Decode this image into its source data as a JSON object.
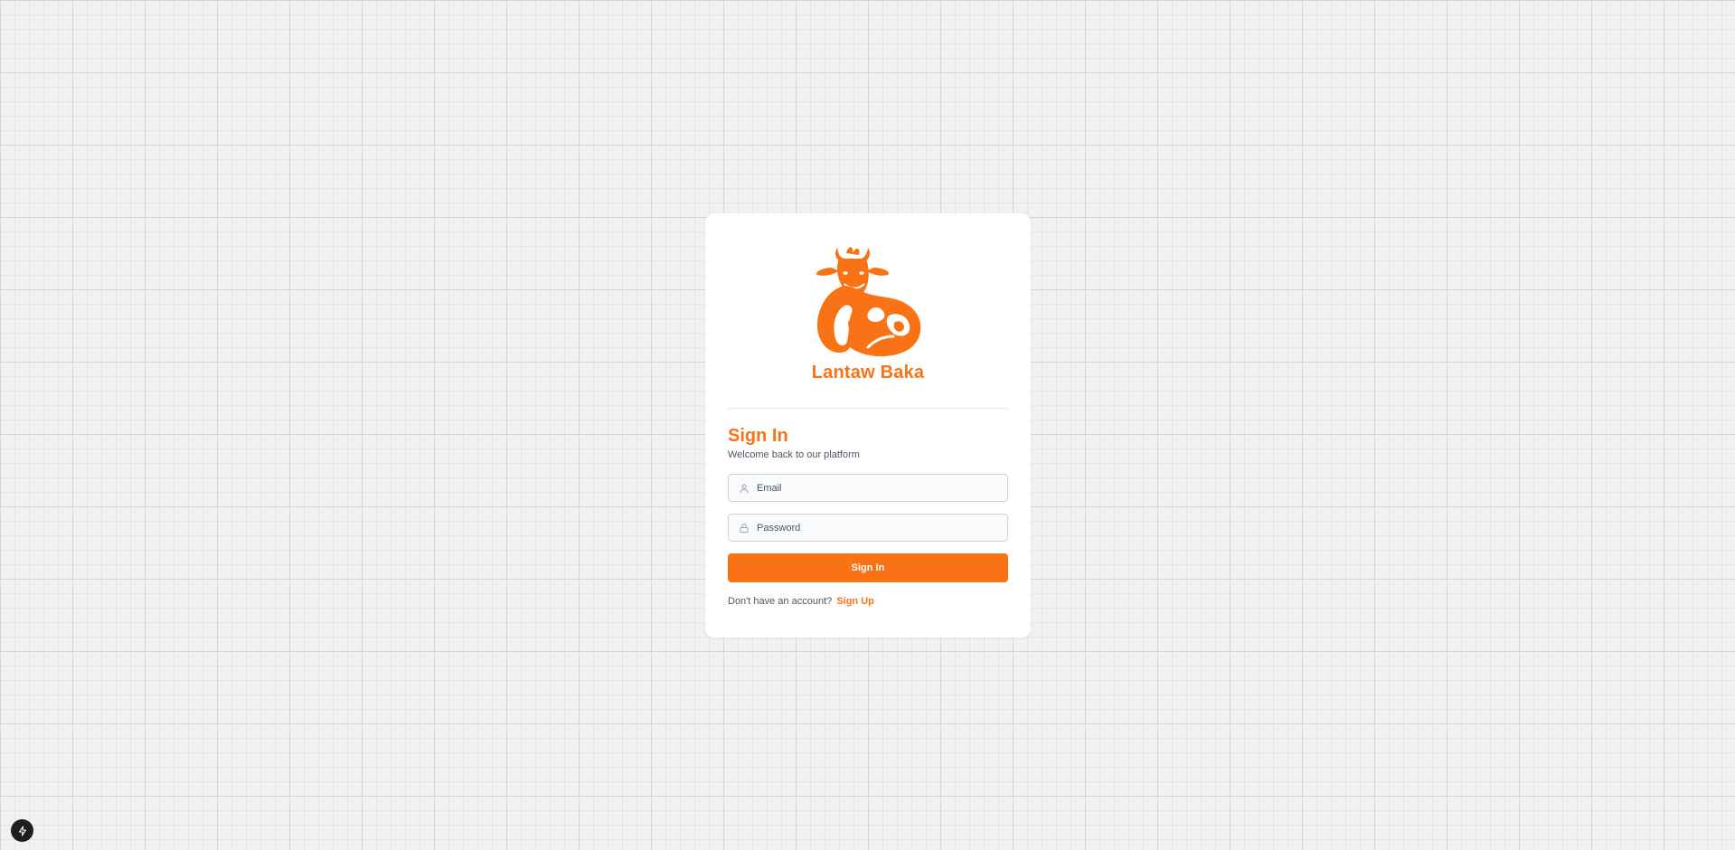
{
  "brand": {
    "name": "Lantaw Baka",
    "accent_color": "#f97316",
    "logo_icon": "cow-logo"
  },
  "form": {
    "title": "Sign In",
    "subtitle": "Welcome back to our platform",
    "email": {
      "placeholder": "Email",
      "value": "",
      "icon": "user-icon"
    },
    "password": {
      "placeholder": "Password",
      "value": "",
      "icon": "lock-icon"
    },
    "submit_label": "Sign In",
    "footer_prompt": "Don't have an account?",
    "footer_link": "Sign Up"
  },
  "corner_badge": {
    "icon": "lightning-bolt-icon"
  }
}
